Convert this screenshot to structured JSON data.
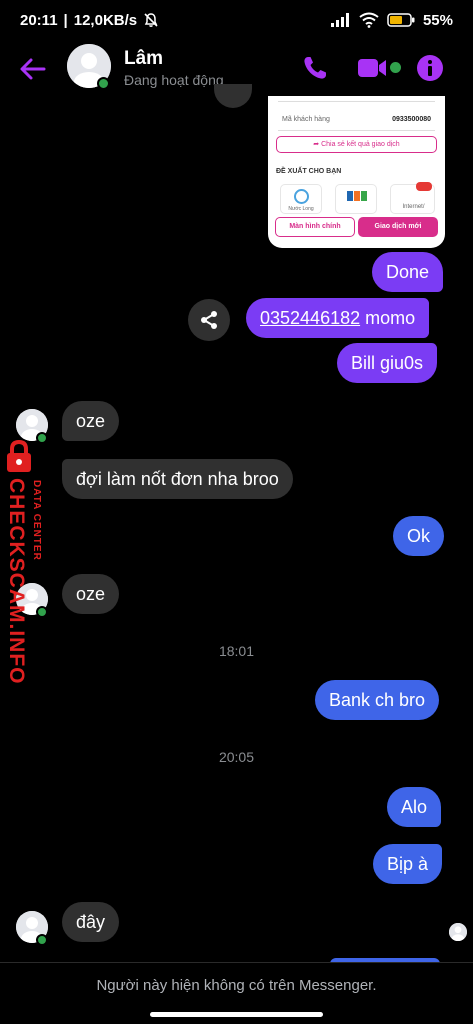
{
  "status_bar": {
    "time": "20:11",
    "speed": "12,0KB/s",
    "battery": "55"
  },
  "header": {
    "name": "Lâm",
    "status": "Đang hoạt động"
  },
  "receipt": {
    "customer_label": "Mã khách hàng",
    "customer_value": "0933500080",
    "share_label": "Chia sẻ kết quả giao dịch",
    "suggest_label": "ĐỀ XUẤT CHO BẠN",
    "tile_1": "Nước Long",
    "tile_3": "Internet/",
    "home_button": "Màn hình chính",
    "new_button": "Giao dịch mới"
  },
  "messages": {
    "m1": "Done",
    "m2_link": "0352446182",
    "m2_text": " momo",
    "m3": "Bill giu0s",
    "m4": "oze",
    "m5": "đợi làm nốt đơn nha broo",
    "m6": "Ok",
    "m7": "oze",
    "time1": "18:01",
    "m8": "Bank ch bro",
    "time2": "20:05",
    "m9": "Alo",
    "m10": "Bịp à",
    "m11": "đây"
  },
  "footer": {
    "notice": "Người này hiện không có trên Messenger."
  },
  "watermark": {
    "site": "CHECKSCAM.INFO",
    "tag": "DATA CENTER"
  },
  "colors": {
    "accent": "#a833f5",
    "sent_purple": "#7b3cf4",
    "sent_blue": "#3f65e8",
    "received": "#303030",
    "online": "#31a24c"
  }
}
